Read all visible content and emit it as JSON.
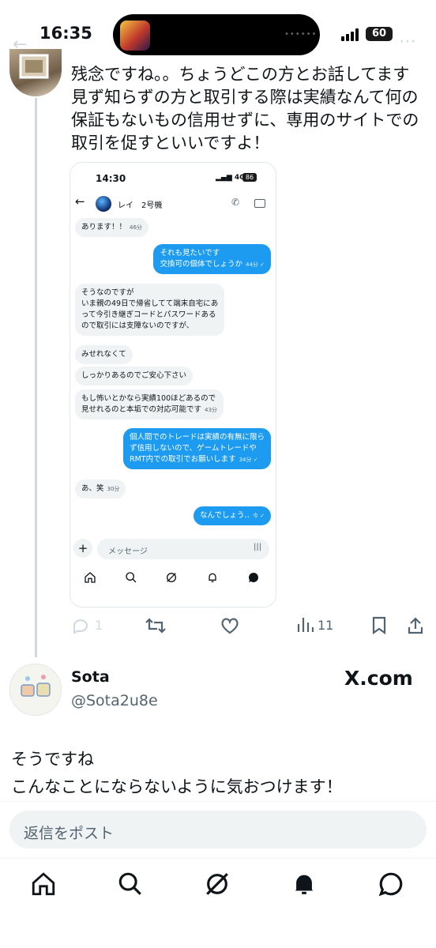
{
  "status_bar": {
    "time": "16:35",
    "battery": "60"
  },
  "tweet1": {
    "lines": [
      "残念ですね。。ちょうどこの方とお話してます",
      "見ず知らずの方と取引する際は実績なんて何の",
      "保証もないもの信用せずに、専用のサイトでの",
      "取引を促すといいですよ！"
    ]
  },
  "screenshot": {
    "time": "14:30",
    "network": "4G",
    "battery": "86",
    "contact_name": "レイ　2号機",
    "messages": [
      {
        "dir": "in",
        "text": "あります！！",
        "time": "46分"
      },
      {
        "dir": "out",
        "text": "それも見たいです\n交換可の個体でしょうか",
        "time": "44分"
      },
      {
        "dir": "in",
        "text": "そうなのですが\nいま親の49日で帰省してて端末自宅にあ\nって今引き継ぎコードとパスワードある\nので取引には支障ないのですが、",
        "time": ""
      },
      {
        "dir": "in",
        "text": "みせれなくて",
        "time": ""
      },
      {
        "dir": "in",
        "text": "しっかりあるのでご安心下さい",
        "time": ""
      },
      {
        "dir": "in",
        "text": "もし怖いとかなら実績100ほどあるので\n見せれるのと本垢での対応可能です",
        "time": "43分"
      },
      {
        "dir": "out",
        "text": "個人間でのトレードは実績の有無に限ら\nず信用しないので、ゲームトレードや\nRMT内での取引でお願いします",
        "time": "34分"
      },
      {
        "dir": "in",
        "text": "あ、笑",
        "time": "30分"
      },
      {
        "dir": "out",
        "text": "なんでしょう‥",
        "time": "今"
      }
    ],
    "input_placeholder": "メッセージ"
  },
  "actions": {
    "replies": "1",
    "views": "11"
  },
  "tweet2": {
    "name": "Sota",
    "handle": "@Sota2u8e",
    "watermark": "X.com",
    "lines": [
      "そうですね",
      "こんなことにならないように気おつけます！"
    ]
  },
  "reply_placeholder": "返信をポスト",
  "colors": {
    "accent": "#1d9bf0",
    "text": "#0f1419",
    "muted": "#536471"
  },
  "icons": [
    "home-icon",
    "search-icon",
    "grok-icon",
    "notifications-icon",
    "messages-icon"
  ]
}
